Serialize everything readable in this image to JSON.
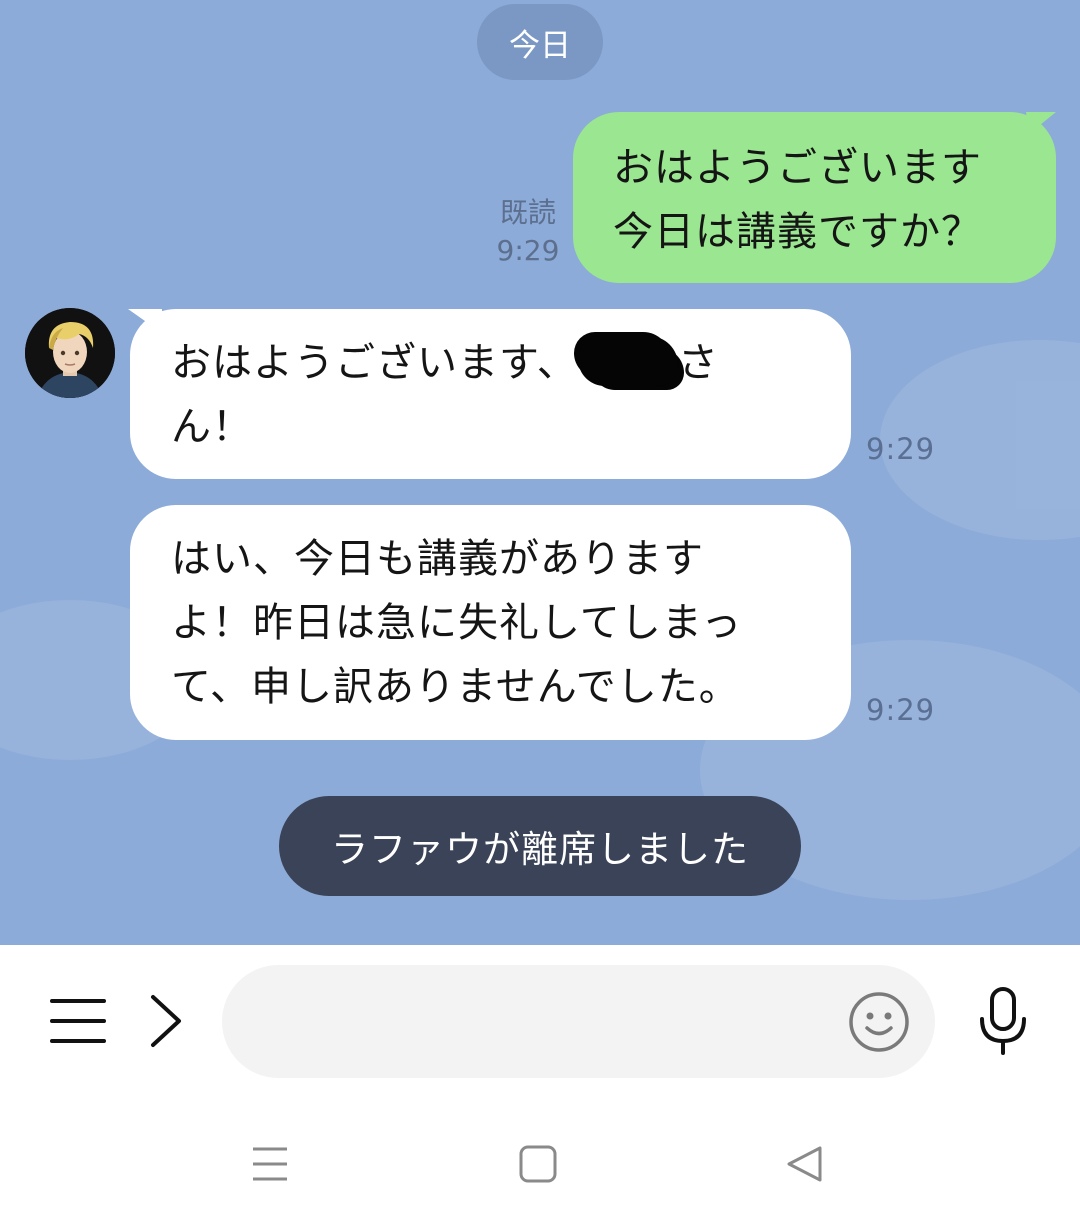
{
  "chat": {
    "date_label": "今日",
    "messages": [
      {
        "direction": "outgoing",
        "lines": [
          "おはようございます",
          "今日は講義ですか？"
        ],
        "read_label": "既読",
        "time": "9:29"
      },
      {
        "direction": "incoming",
        "line1_before": "おはようございます、",
        "line1_after": "さ",
        "line2": "ん！",
        "time": "9:29"
      },
      {
        "direction": "incoming",
        "lines": [
          "はい、今日も講義があります",
          "よ！昨日は急に失礼してしまっ",
          "て、申し訳ありませんでした。"
        ],
        "time": "9:29"
      }
    ],
    "status_notice": "ラファウが離席しました"
  },
  "input_bar": {
    "menu_icon": "hamburger-menu-icon",
    "expand_icon": "chevron-right-icon",
    "message_placeholder": "",
    "emoji_icon": "smiley-icon",
    "mic_icon": "microphone-icon"
  },
  "system_nav": {
    "recents_icon": "recents-icon",
    "home_icon": "home-icon",
    "back_icon": "back-triangle-icon"
  },
  "colors": {
    "chat_background": "#8cabd8",
    "outgoing_bubble": "#9ae691",
    "incoming_bubble": "#ffffff",
    "notice_pill": "#3a4357",
    "date_pill": "#7b98c5"
  }
}
